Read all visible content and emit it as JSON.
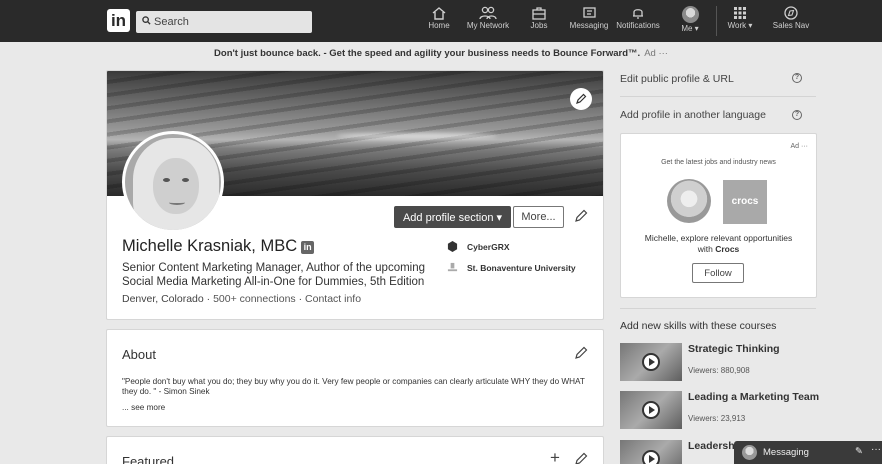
{
  "nav": {
    "logo": "in",
    "search_placeholder": "Search",
    "items": [
      {
        "label": "Home",
        "icon": "home-icon"
      },
      {
        "label": "My Network",
        "icon": "people-icon"
      },
      {
        "label": "Jobs",
        "icon": "briefcase-icon"
      },
      {
        "label": "Messaging",
        "icon": "chat-icon"
      },
      {
        "label": "Notifications",
        "icon": "bell-icon"
      },
      {
        "label": "Me ▾",
        "icon": "avatar"
      },
      {
        "label": "Work ▾",
        "icon": "grid-icon"
      },
      {
        "label": "Sales Nav",
        "icon": "compass-icon"
      }
    ]
  },
  "ad_banner": {
    "lead": "Don't just bounce back.",
    "text": " - Get the speed and agility your business needs to Bounce Forward™.",
    "tag": "Ad ···"
  },
  "profile": {
    "name": "Michelle Krasniak, MBC",
    "badge": "in",
    "headline": "Senior Content Marketing Manager, Author of the upcoming Social Media Marketing All-in-One for Dummies, 5th Edition",
    "location": "Denver, Colorado",
    "sep": "·",
    "connections": "500+ connections",
    "contact": "Contact info",
    "add_section_label": "Add profile section ▾",
    "more_label": "More...",
    "company": "CyberGRX",
    "school": "St. Bonaventure University"
  },
  "about": {
    "title": "About",
    "text": "\"People don't buy what you do; they buy why you do it. Very few people or companies can clearly articulate WHY they do WHAT they do. \" - Simon Sinek",
    "see_more": "... see more"
  },
  "featured": {
    "title": "Featured",
    "add": "+"
  },
  "sidebar": {
    "edit_public_profile": "Edit public profile & URL",
    "add_language": "Add profile in another language",
    "help": "?"
  },
  "ad_card": {
    "tag": "Ad ···",
    "tagline": "Get the latest jobs and industry news",
    "logo_text": "crocs",
    "line1": "Michelle, explore relevant opportunities",
    "line2_prefix": "with ",
    "line2_company": "Crocs",
    "follow_label": "Follow"
  },
  "skills": {
    "title": "Add new skills with these courses",
    "courses": [
      {
        "title": "Strategic Thinking",
        "views": "Viewers: 880,908"
      },
      {
        "title": "Leading a Marketing Team",
        "views": "Viewers: 23,913"
      },
      {
        "title": "Leadershi",
        "views": ""
      }
    ]
  },
  "messaging": {
    "label": "Messaging",
    "compose": "✎",
    "more": "···"
  }
}
